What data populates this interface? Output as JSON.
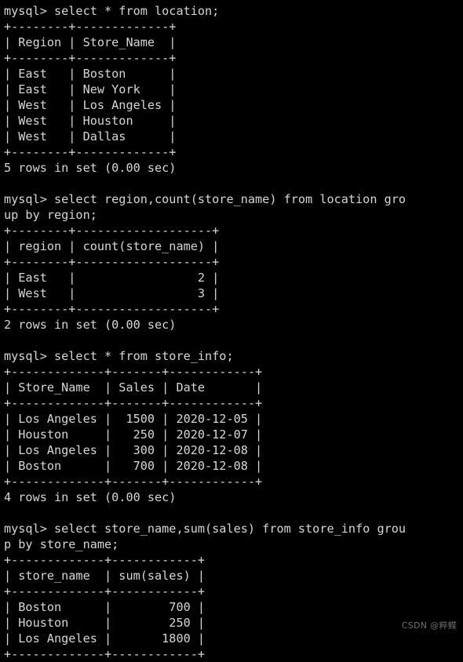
{
  "terminal": {
    "prompt": "mysql> ",
    "lines": [
      "mysql> select * from location;",
      "+--------+-------------+",
      "| Region | Store_Name  |",
      "+--------+-------------+",
      "| East   | Boston      |",
      "| East   | New York    |",
      "| West   | Los Angeles |",
      "| West   | Houston     |",
      "| West   | Dallas      |",
      "+--------+-------------+",
      "5 rows in set (0.00 sec)",
      "",
      "mysql> select region,count(store_name) from location gro",
      "up by region;",
      "+--------+-------------------+",
      "| region | count(store_name) |",
      "+--------+-------------------+",
      "| East   |                 2 |",
      "| West   |                 3 |",
      "+--------+-------------------+",
      "2 rows in set (0.00 sec)",
      "",
      "mysql> select * from store_info;",
      "+-------------+-------+------------+",
      "| Store_Name  | Sales | Date       |",
      "+-------------+-------+------------+",
      "| Los Angeles |  1500 | 2020-12-05 |",
      "| Houston     |   250 | 2020-12-07 |",
      "| Los Angeles |   300 | 2020-12-08 |",
      "| Boston      |   700 | 2020-12-08 |",
      "+-------------+-------+------------+",
      "4 rows in set (0.00 sec)",
      "",
      "mysql> select store_name,sum(sales) from store_info grou",
      "p by store_name;",
      "+-------------+------------+",
      "| store_name  | sum(sales) |",
      "+-------------+------------+",
      "| Boston      |        700 |",
      "| Houston     |        250 |",
      "| Los Angeles |       1800 |",
      "+-------------+------------+"
    ],
    "queries": [
      {
        "sql": "select * from location;",
        "table": {
          "columns": [
            "Region",
            "Store_Name"
          ],
          "rows": [
            [
              "East",
              "Boston"
            ],
            [
              "East",
              "New York"
            ],
            [
              "West",
              "Los Angeles"
            ],
            [
              "West",
              "Houston"
            ],
            [
              "West",
              "Dallas"
            ]
          ]
        },
        "status": "5 rows in set (0.00 sec)"
      },
      {
        "sql": "select region,count(store_name) from location group by region;",
        "table": {
          "columns": [
            "region",
            "count(store_name)"
          ],
          "rows": [
            [
              "East",
              "2"
            ],
            [
              "West",
              "3"
            ]
          ]
        },
        "status": "2 rows in set (0.00 sec)"
      },
      {
        "sql": "select * from store_info;",
        "table": {
          "columns": [
            "Store_Name",
            "Sales",
            "Date"
          ],
          "rows": [
            [
              "Los Angeles",
              "1500",
              "2020-12-05"
            ],
            [
              "Houston",
              "250",
              "2020-12-07"
            ],
            [
              "Los Angeles",
              "300",
              "2020-12-08"
            ],
            [
              "Boston",
              "700",
              "2020-12-08"
            ]
          ]
        },
        "status": "4 rows in set (0.00 sec)"
      },
      {
        "sql": "select store_name,sum(sales) from store_info group by store_name;",
        "table": {
          "columns": [
            "store_name",
            "sum(sales)"
          ],
          "rows": [
            [
              "Boston",
              "700"
            ],
            [
              "Houston",
              "250"
            ],
            [
              "Los Angeles",
              "1800"
            ]
          ]
        },
        "status": ""
      }
    ]
  },
  "watermark": {
    "text": "CSDN @粹鲽"
  },
  "colors": {
    "background": "#000000",
    "text": "#d6d6d6",
    "watermark": "#6d6d6d"
  }
}
